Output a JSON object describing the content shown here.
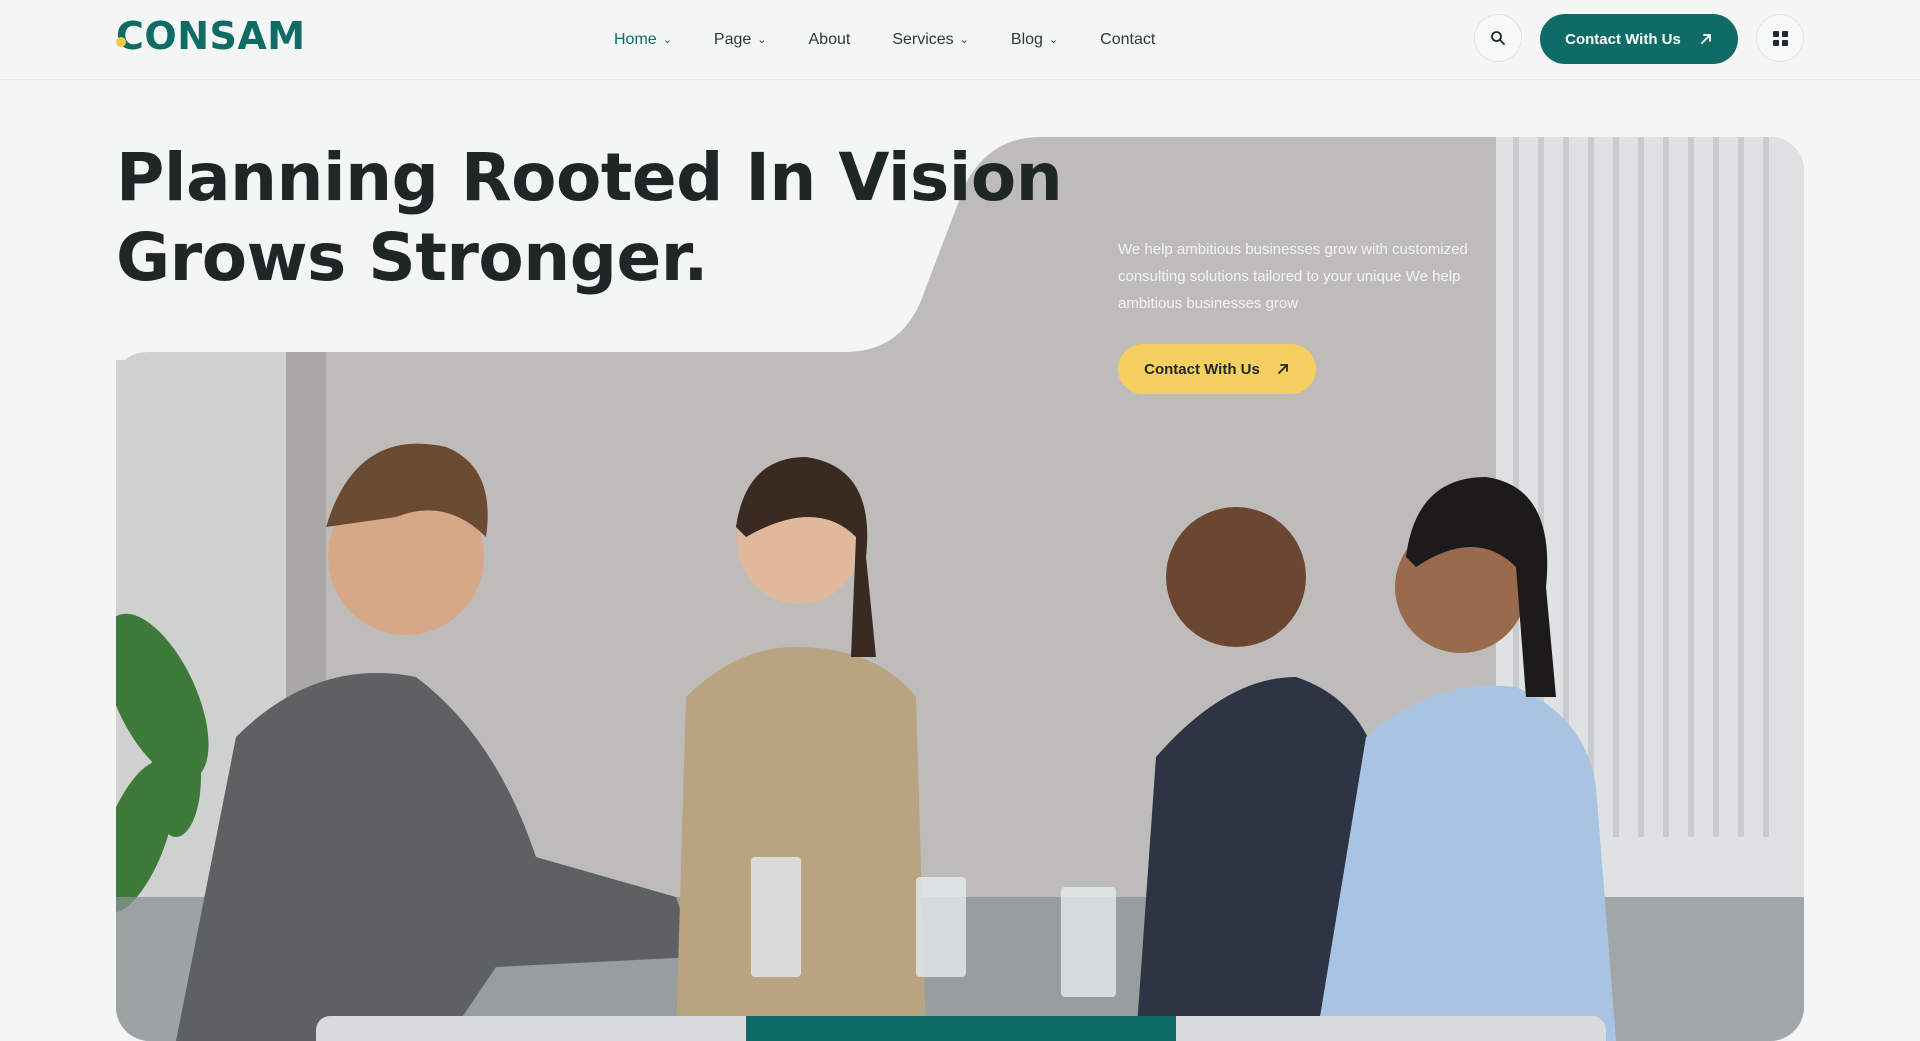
{
  "brand": {
    "name": "CONSAM",
    "accent": "#0f6b66",
    "highlight": "#f5d061"
  },
  "nav": {
    "items": [
      {
        "label": "Home",
        "dropdown": true
      },
      {
        "label": "Page",
        "dropdown": true
      },
      {
        "label": "About",
        "dropdown": false
      },
      {
        "label": "Services",
        "dropdown": true
      },
      {
        "label": "Blog",
        "dropdown": true
      },
      {
        "label": "Contact",
        "dropdown": false
      }
    ],
    "active": "Home"
  },
  "header": {
    "search_icon": "search-icon",
    "cta_label": "Contact With Us",
    "cta_icon": "arrow-up-right-icon",
    "menu_icon": "grid-icon"
  },
  "hero": {
    "title_line1": "Planning Rooted In Vision",
    "title_line2": "Grows Stronger.",
    "description": "We help ambitious businesses grow with customized consulting solutions tailored to your unique We help ambitious businesses grow",
    "cta_label": "Contact With Us",
    "cta_icon": "arrow-up-right-icon"
  }
}
